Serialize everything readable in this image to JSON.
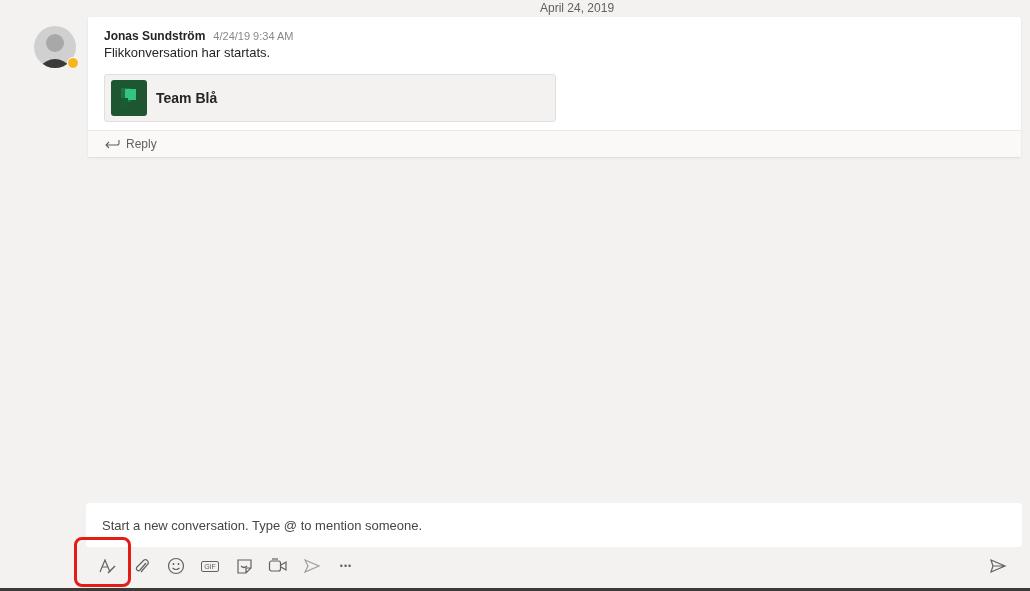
{
  "date_divider": "April 24, 2019",
  "message": {
    "author": "Jonas Sundström",
    "time": "4/24/19 9:34 AM",
    "text": "Flikkonversation har startats.",
    "attachment": {
      "title": "Team Blå"
    },
    "reply": "Reply"
  },
  "composer": {
    "placeholder": "Start a new conversation. Type @ to mention someone."
  },
  "toolbar": [
    {
      "kind": "format",
      "highlighted": true
    },
    {
      "kind": "attach",
      "highlighted": false
    },
    {
      "kind": "emoji",
      "highlighted": false
    },
    {
      "kind": "gif",
      "label": "GIF",
      "highlighted": false
    },
    {
      "kind": "sticker",
      "highlighted": false
    },
    {
      "kind": "meet",
      "highlighted": false
    },
    {
      "kind": "stream",
      "highlighted": false
    },
    {
      "kind": "more",
      "label": "•••",
      "highlighted": false
    }
  ]
}
